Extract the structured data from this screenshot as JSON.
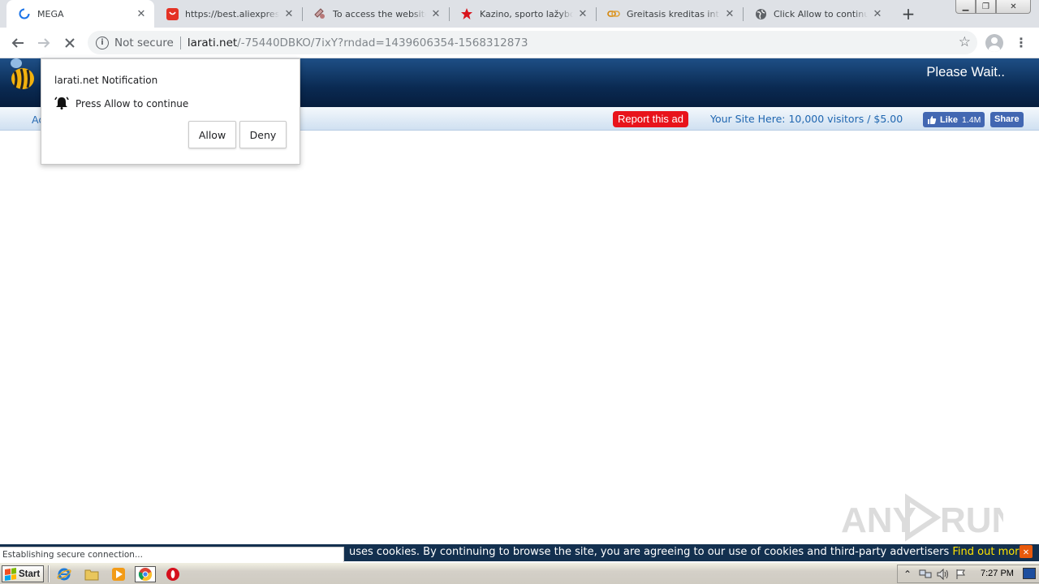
{
  "browser": {
    "tabs": [
      {
        "title": "MEGA",
        "favicon": "loading-spinner-icon",
        "active": true
      },
      {
        "title": "https://best.aliexpress.c",
        "favicon": "aliexpress-icon",
        "active": false
      },
      {
        "title": "To access the website c",
        "favicon": "puzzle-icon",
        "active": false
      },
      {
        "title": "Kazino, sporto lažybos ir",
        "favicon": "red-star-icon",
        "active": false
      },
      {
        "title": "Greitasis kreditas interne",
        "favicon": "chain-icon",
        "active": false
      },
      {
        "title": "Click Allow to continue",
        "favicon": "globe-icon",
        "active": false
      }
    ],
    "omnibox": {
      "security_label": "Not secure",
      "host": "larati.net",
      "path": "/-75440DBKO/7ixY?rndad=1439606354-1568312873"
    }
  },
  "notification": {
    "origin": "larati.net Notification",
    "message": "Press Allow to continue",
    "allow_label": "Allow",
    "deny_label": "Deny"
  },
  "page": {
    "please_wait": "Please Wait..",
    "nav_fragment": "Ac",
    "report_ad": "Report this ad",
    "your_site": "Your Site Here: 10,000 visitors / $5.00",
    "fb_like_label": "Like",
    "fb_like_count": "1.4M",
    "fb_share_label": "Share",
    "cookie_text": "uses cookies. By continuing to browse the site, you are agreeing to our use of cookies and third-party advertisers",
    "cookie_link": "Find out more.",
    "cookie_close": "✕",
    "watermark": "ANY RUN"
  },
  "status": {
    "text": "Establishing secure connection..."
  },
  "taskbar": {
    "start_label": "Start",
    "clock": "7:27 PM"
  },
  "colors": {
    "header_blue": "#0a2a52",
    "report_red": "#e8131b",
    "facebook_blue": "#4267b2",
    "cookie_bar": "#13304f",
    "cookie_link": "#ffe400"
  }
}
